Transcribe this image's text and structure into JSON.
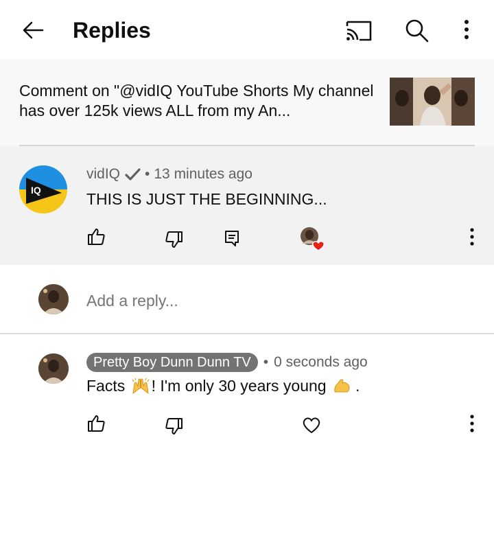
{
  "header": {
    "title": "Replies",
    "icons": {
      "back": "arrow-left-icon",
      "cast": "cast-icon",
      "search": "search-icon",
      "more": "more-vert-icon"
    }
  },
  "context": {
    "text": "Comment on \"@vidIQ YouTube Shorts My channel has over 125k views ALL from my An..."
  },
  "parent_comment": {
    "author": "vidIQ",
    "separator": "•",
    "time": "13 minutes ago",
    "text": "THIS IS JUST THE BEGINNING...",
    "avatar_text": "IQ",
    "actions": [
      "thumb-up-icon",
      "thumb-down-icon",
      "reply-icon",
      "creator-heart-icon",
      "more-vert-icon"
    ]
  },
  "reply_box": {
    "placeholder": "Add a reply..."
  },
  "reply": {
    "author": "Pretty Boy Dunn Dunn TV",
    "separator": "•",
    "time": "0 seconds ago",
    "text_part1": "Facts ",
    "text_part2": "! I'm only 30 years young ",
    "text_part3": ".",
    "emojis": [
      "raising-hands-emoji",
      "flexed-biceps-emoji"
    ],
    "actions": [
      "thumb-up-icon",
      "thumb-down-icon",
      "heart-icon",
      "more-vert-icon"
    ]
  },
  "colors": {
    "accent_heart": "#e62117",
    "vidiq_yellow": "#f5c518",
    "vidiq_blue": "#1e8fe1",
    "badge_gray": "#737373"
  }
}
